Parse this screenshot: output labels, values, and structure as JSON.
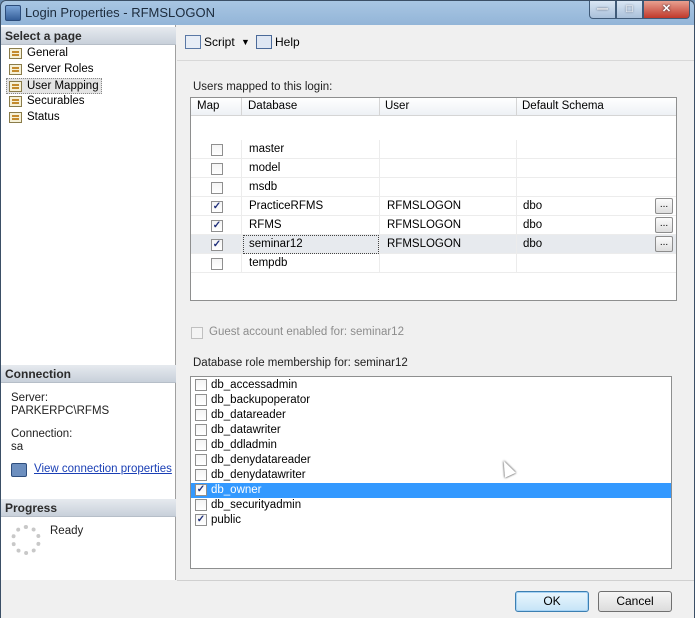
{
  "window": {
    "title": "Login Properties - RFMSLOGON"
  },
  "sidebar": {
    "select_page_header": "Select a page",
    "items": [
      {
        "label": "General"
      },
      {
        "label": "Server Roles"
      },
      {
        "label": "User Mapping",
        "selected": true
      },
      {
        "label": "Securables"
      },
      {
        "label": "Status"
      }
    ],
    "connection_header": "Connection",
    "server_label": "Server:",
    "server_value": "PARKERPC\\RFMS",
    "connection_label": "Connection:",
    "connection_value": "sa",
    "view_connection_link": "View connection properties",
    "progress_header": "Progress",
    "progress_status": "Ready"
  },
  "toolbar": {
    "script_label": "Script",
    "help_label": "Help"
  },
  "users_mapped": {
    "label": "Users mapped to this login:",
    "columns": [
      "Map",
      "Database",
      "User",
      "Default Schema"
    ],
    "rows": [
      {
        "map": false,
        "database": "master",
        "user": "",
        "schema": ""
      },
      {
        "map": false,
        "database": "model",
        "user": "",
        "schema": ""
      },
      {
        "map": false,
        "database": "msdb",
        "user": "",
        "schema": ""
      },
      {
        "map": true,
        "database": "PracticeRFMS",
        "user": "RFMSLOGON",
        "schema": "dbo"
      },
      {
        "map": true,
        "database": "RFMS",
        "user": "RFMSLOGON",
        "schema": "dbo"
      },
      {
        "map": true,
        "database": "seminar12",
        "user": "RFMSLOGON",
        "schema": "dbo",
        "selected": true
      },
      {
        "map": false,
        "database": "tempdb",
        "user": "",
        "schema": ""
      }
    ]
  },
  "guest_account": {
    "label": "Guest account enabled for: seminar12",
    "checked": false
  },
  "role_membership": {
    "label": "Database role membership for: seminar12",
    "roles": [
      {
        "name": "db_accessadmin",
        "checked": false
      },
      {
        "name": "db_backupoperator",
        "checked": false
      },
      {
        "name": "db_datareader",
        "checked": false
      },
      {
        "name": "db_datawriter",
        "checked": false
      },
      {
        "name": "db_ddladmin",
        "checked": false
      },
      {
        "name": "db_denydatareader",
        "checked": false
      },
      {
        "name": "db_denydatawriter",
        "checked": false
      },
      {
        "name": "db_owner",
        "checked": true,
        "selected": true
      },
      {
        "name": "db_securityadmin",
        "checked": false
      },
      {
        "name": "public",
        "checked": true
      }
    ]
  },
  "buttons": {
    "ok": "OK",
    "cancel": "Cancel"
  }
}
